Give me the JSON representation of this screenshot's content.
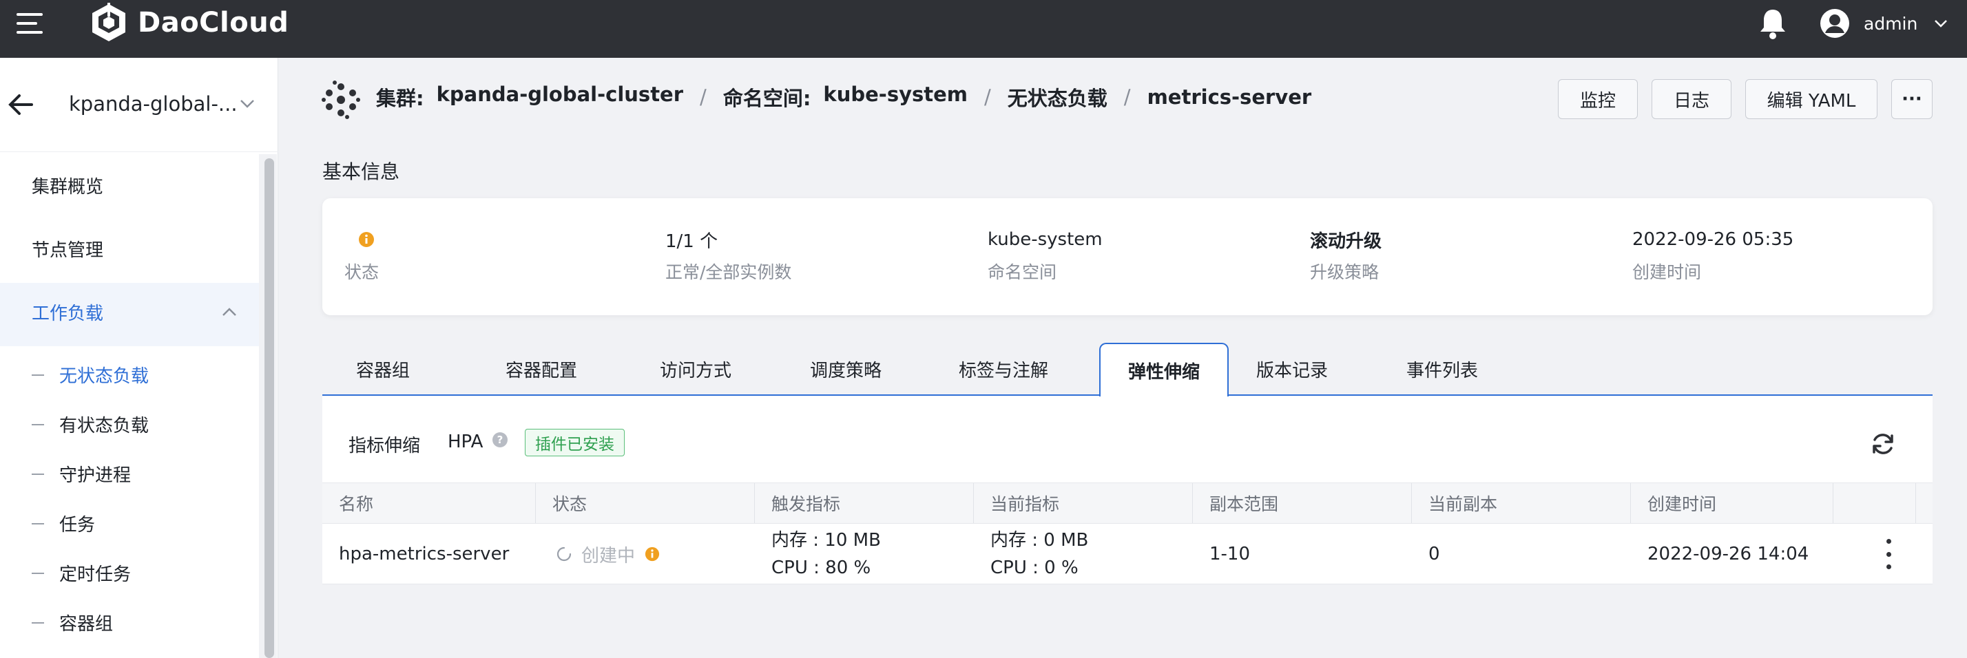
{
  "topbar": {
    "brand": "DaoCloud",
    "user": "admin",
    "colors": {
      "bar": "#2f3136",
      "accent": "#2f6fd6"
    }
  },
  "sidebar": {
    "cluster": "kpanda-global-...",
    "items": [
      {
        "label": "集群概览"
      },
      {
        "label": "节点管理"
      },
      {
        "label": "工作负载",
        "expanded": true,
        "active": true
      }
    ],
    "subitems": [
      {
        "label": "无状态负载",
        "active": true
      },
      {
        "label": "有状态负载"
      },
      {
        "label": "守护进程"
      },
      {
        "label": "任务"
      },
      {
        "label": "定时任务"
      },
      {
        "label": "容器组"
      }
    ]
  },
  "breadcrumb": {
    "cluster_key": "集群:",
    "cluster_val": "kpanda-global-cluster",
    "ns_key": "命名空间:",
    "ns_val": "kube-system",
    "type": "无状态负载",
    "name": "metrics-server"
  },
  "actions": {
    "monitor": "监控",
    "logs": "日志",
    "edit_yaml": "编辑 YAML",
    "more": "···"
  },
  "basic_info": {
    "title": "基本信息",
    "status_label": "状态",
    "replicas_value": "1/1 个",
    "replicas_label": "正常/全部实例数",
    "namespace_value": "kube-system",
    "namespace_label": "命名空间",
    "strategy_value": "滚动升级",
    "strategy_label": "升级策略",
    "created_value": "2022-09-26 05:35",
    "created_label": "创建时间"
  },
  "tabs": [
    {
      "label": "容器组"
    },
    {
      "label": "容器配置"
    },
    {
      "label": "访问方式"
    },
    {
      "label": "调度策略"
    },
    {
      "label": "标签与注解"
    },
    {
      "label": "弹性伸缩",
      "active": true
    },
    {
      "label": "版本记录"
    },
    {
      "label": "事件列表"
    }
  ],
  "scaling": {
    "title": "指标伸缩",
    "type": "HPA",
    "badge": "插件已安装",
    "columns": [
      "名称",
      "状态",
      "触发指标",
      "当前指标",
      "副本范围",
      "当前副本",
      "创建时间"
    ],
    "rows": [
      {
        "name": "hpa-metrics-server",
        "status": "创建中",
        "trigger_mem": "内存 : 10 MB",
        "trigger_cpu": "CPU : 80 %",
        "current_mem": "内存 : 0 MB",
        "current_cpu": "CPU : 0 %",
        "range": "1-10",
        "current_replicas": "0",
        "created": "2022-09-26 14:04"
      }
    ]
  }
}
